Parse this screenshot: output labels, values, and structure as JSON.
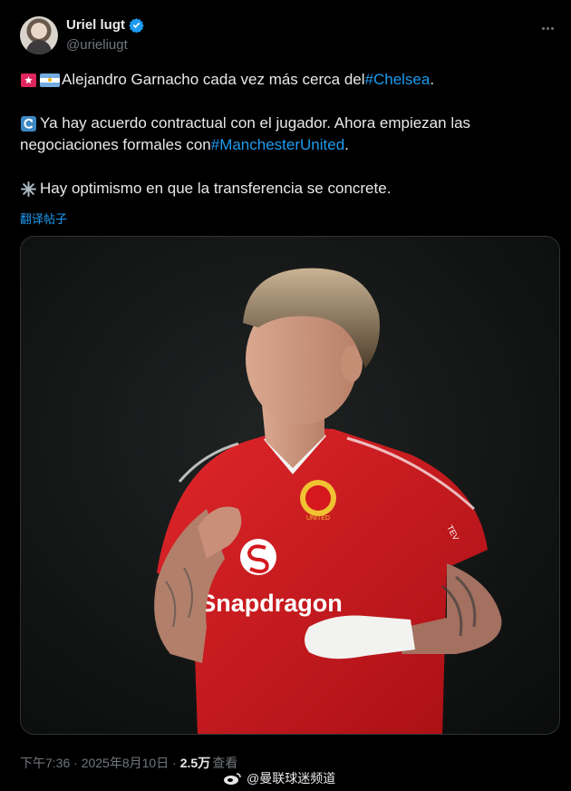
{
  "author": {
    "display_name": "Uriel lugt",
    "handle": "@urieliugt",
    "verified": true
  },
  "tweet": {
    "line1_text": "Alejandro Garnacho cada vez más cerca del ",
    "line1_hashtag": "#Chelsea",
    "line1_end": ".",
    "para2_line1": "Ya hay acuerdo contractual con el jugador. Ahora empiezan las",
    "para2_line2_text": "negociaciones formales con ",
    "para2_hashtag": "#ManchesterUnited",
    "para2_end": ".",
    "para3_text": "Hay optimismo en que la transferencia se concrete.",
    "translate_label": "翻译帖子"
  },
  "icons": [
    "rotating-light-icon",
    "argentina-flag-icon",
    "arrows-icon",
    "sparkle-icon",
    "verified-badge-icon",
    "more-options-icon",
    "weibo-icon"
  ],
  "media": {
    "shirt_sponsor": "Snapdragon",
    "crest_text": "UNITED",
    "colors": {
      "shirt": "#d4181d",
      "background": "#141616"
    }
  },
  "meta": {
    "timestamp": "下午7:36 · 2025年8月10日 · ",
    "views_count": "2.5万",
    "views_label": "查看"
  },
  "watermark": {
    "text": "@曼联球迷频道"
  },
  "colors": {
    "accent": "#1d9bf0",
    "text": "#e7e9ea",
    "muted": "#71767b",
    "background": "#000000"
  }
}
